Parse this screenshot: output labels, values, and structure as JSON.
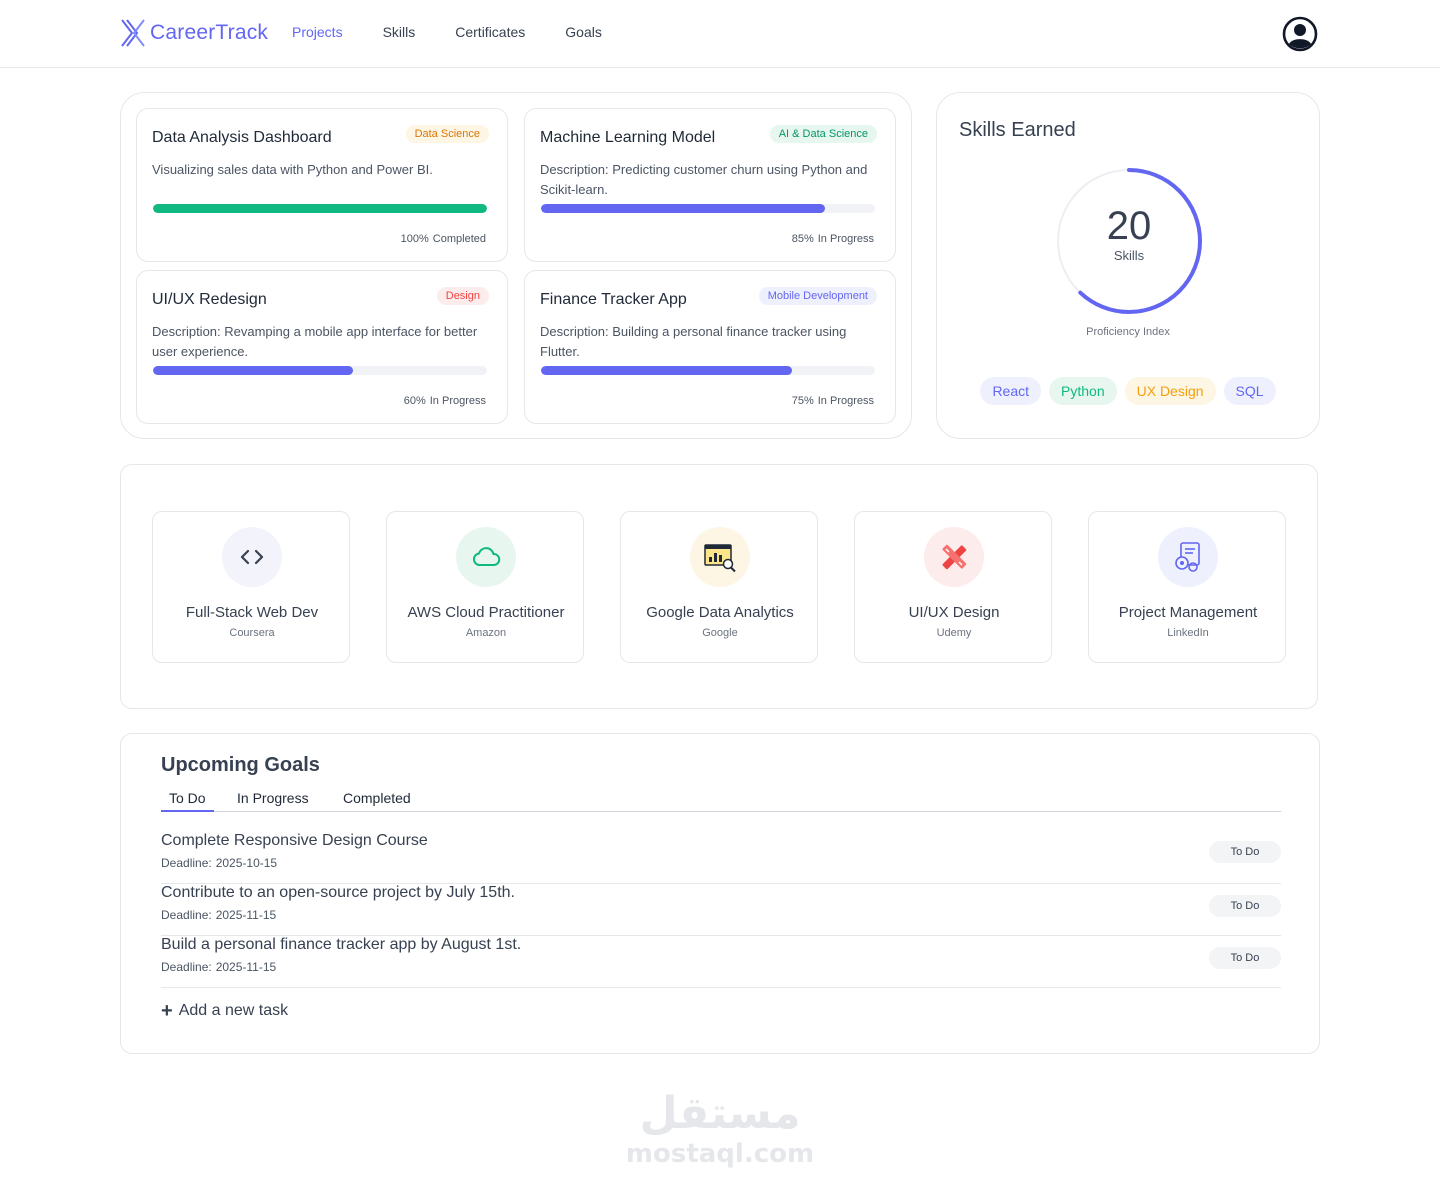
{
  "header": {
    "brand": "CareerTrack",
    "nav": [
      {
        "label": "Projects",
        "active": true
      },
      {
        "label": "Skills",
        "active": false
      },
      {
        "label": "Certificates",
        "active": false
      },
      {
        "label": "Goals",
        "active": false
      }
    ],
    "user_icon": "user-circle-icon"
  },
  "projects": [
    {
      "title": "Data Analysis Dashboard",
      "tag": "Data Science",
      "tag_color": "#d97706",
      "tag_bg": "#fef6e4",
      "description": "Visualizing sales data with Python and Power BI.",
      "progress": 100,
      "progress_color": "#10b981",
      "percent_label": "100%",
      "status": "Completed"
    },
    {
      "title": "Machine Learning Model",
      "tag": "AI & Data Science",
      "tag_color": "#059669",
      "tag_bg": "#e7f7ef",
      "description": "Description: Predicting customer churn using Python and Scikit-learn.",
      "progress": 85,
      "progress_color": "#6366f1",
      "percent_label": "85%",
      "status": "In Progress"
    },
    {
      "title": "UI/UX Redesign",
      "tag": "Design",
      "tag_color": "#ef4444",
      "tag_bg": "#fdecec",
      "description": "Description: Revamping a mobile app interface for better user experience.",
      "progress": 60,
      "progress_color": "#6366f1",
      "percent_label": "60%",
      "status": "In Progress"
    },
    {
      "title": "Finance Tracker App",
      "tag": "Mobile Development",
      "tag_color": "#6366f1",
      "tag_bg": "#eef0fd",
      "description": "Description: Building a personal finance tracker using Flutter.",
      "progress": 75,
      "progress_color": "#6366f1",
      "percent_label": "75%",
      "status": "In Progress"
    }
  ],
  "skills": {
    "title": "Skills Earned",
    "count": "20",
    "count_label": "Skills",
    "ring_fraction": 0.62,
    "ring_color": "#6366f1",
    "index_label": "Proficiency Index",
    "chips": [
      {
        "label": "React",
        "color": "#6366f1",
        "bg": "#eef0fd"
      },
      {
        "label": "Python",
        "color": "#10b981",
        "bg": "#e7f7ef"
      },
      {
        "label": "UX Design",
        "color": "#f59e0b",
        "bg": "#fef6e4"
      },
      {
        "label": "SQL",
        "color": "#6366f1",
        "bg": "#eef0fd"
      }
    ]
  },
  "certificates": [
    {
      "name": "Full-Stack Web Dev",
      "issuer": "Coursera",
      "icon": "code-icon",
      "icon_bg": "#f3f4fb"
    },
    {
      "name": "AWS Cloud Practitioner",
      "issuer": "Amazon",
      "icon": "cloud-icon",
      "icon_bg": "#e7f7ef"
    },
    {
      "name": "Google Data Analytics",
      "issuer": "Google",
      "icon": "analytics-icon",
      "icon_bg": "#fef6e4"
    },
    {
      "name": "UI/UX Design",
      "issuer": "Udemy",
      "icon": "design-tools-icon",
      "icon_bg": "#fdecec"
    },
    {
      "name": "Project Management",
      "issuer": "LinkedIn",
      "icon": "project-management-icon",
      "icon_bg": "#eef0fd"
    }
  ],
  "goals": {
    "title": "Upcoming Goals",
    "tabs": [
      {
        "label": "To Do",
        "active": true
      },
      {
        "label": "In Progress",
        "active": false
      },
      {
        "label": "Completed",
        "active": false
      }
    ],
    "items": [
      {
        "title": "Complete Responsive Design Course",
        "deadline_label": "Deadline:",
        "deadline": "2025-10-15",
        "status": "To Do"
      },
      {
        "title": "Contribute to an open-source project by July 15th.",
        "deadline_label": "Deadline:",
        "deadline": "2025-11-15",
        "status": "To Do"
      },
      {
        "title": "Build a personal finance tracker app by August 1st.",
        "deadline_label": "Deadline:",
        "deadline": "2025-11-15",
        "status": "To Do"
      }
    ],
    "add_label": "Add a new task"
  },
  "watermark": {
    "arabic": "مستقل",
    "latin": "mostaql.com"
  }
}
